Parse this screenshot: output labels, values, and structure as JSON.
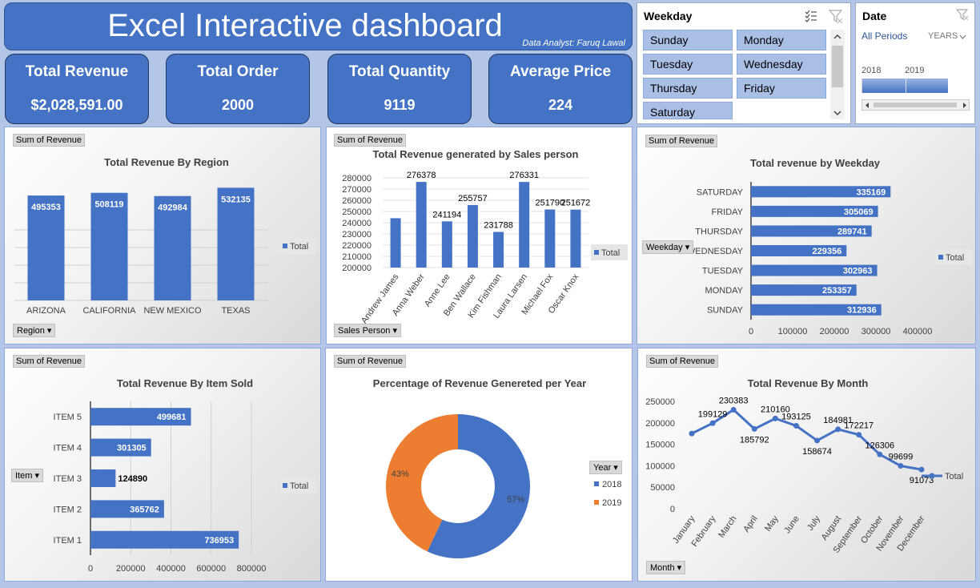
{
  "header": {
    "title": "Excel Interactive dashboard",
    "analyst": "Data Analyst: Faruq Lawal"
  },
  "kpis": [
    {
      "label": "Total Revenue",
      "value": "$2,028,591.00"
    },
    {
      "label": "Total Order",
      "value": "2000"
    },
    {
      "label": "Total Quantity",
      "value": "9119"
    },
    {
      "label": "Average Price",
      "value": "224"
    }
  ],
  "weekday_slicer": {
    "title": "Weekday",
    "items": [
      "Sunday",
      "Monday",
      "Tuesday",
      "Wednesday",
      "Thursday",
      "Friday",
      "Saturday"
    ]
  },
  "date_slicer": {
    "title": "Date",
    "period": "All Periods",
    "level": "YEARS",
    "years": [
      "2018",
      "2019"
    ]
  },
  "field_buttons": {
    "sum": "Sum of Revenue",
    "region": "Region",
    "sales_person": "Sales Person",
    "weekday": "Weekday",
    "item": "Item",
    "year": "Year",
    "month": "Month"
  },
  "colors": {
    "blue": "#4472c4",
    "orange": "#ed7d31",
    "header": "#4472c4",
    "background": "#b4c6e7"
  },
  "chart_data": [
    {
      "id": "region",
      "type": "bar",
      "title": "Total Revenue By Region",
      "categories": [
        "ARIZONA",
        "CALIFORNIA",
        "NEW MEXICO",
        "TEXAS"
      ],
      "series": [
        {
          "name": "Total",
          "values": [
            495353,
            508119,
            492984,
            532135
          ]
        }
      ],
      "legend": "right"
    },
    {
      "id": "salesperson",
      "type": "bar",
      "title": "Total Revenue generated by Sales person",
      "categories": [
        "Andrew James",
        "Anna Weber",
        "Anne Lee",
        "Ben Wallace",
        "Kim Fishman",
        "Laura Larsen",
        "Michael Fox",
        "Oscar Knox"
      ],
      "series": [
        {
          "name": "Total",
          "values": [
            244000,
            276378,
            241194,
            255757,
            231788,
            276331,
            251790,
            251672
          ]
        }
      ],
      "ylim": [
        200000,
        280000
      ],
      "yticks": [
        "200000",
        "210000",
        "220000",
        "230000",
        "240000",
        "250000",
        "260000",
        "270000",
        "280000"
      ],
      "data_labels": [
        "",
        "276378",
        "241194",
        "255757",
        "231788",
        "276331",
        "251790",
        "251672"
      ],
      "legend": "right"
    },
    {
      "id": "weekday",
      "type": "bar",
      "orientation": "horizontal",
      "title": "Total revenue by Weekday",
      "categories": [
        "SATURDAY",
        "FRIDAY",
        "THURSDAY",
        "WEDNESDAY",
        "TUESDAY",
        "MONDAY",
        "SUNDAY"
      ],
      "series": [
        {
          "name": "Total",
          "values": [
            335169,
            305069,
            289741,
            229356,
            302963,
            253357,
            312936
          ]
        }
      ],
      "xlim": [
        0,
        400000
      ],
      "xticks": [
        "0",
        "100000",
        "200000",
        "300000",
        "400000"
      ],
      "legend": "right"
    },
    {
      "id": "item",
      "type": "bar",
      "orientation": "horizontal",
      "title": "Total Revenue By Item Sold",
      "categories": [
        "ITEM 5",
        "ITEM 4",
        "ITEM 3",
        "ITEM 2",
        "ITEM 1"
      ],
      "series": [
        {
          "name": "Total",
          "values": [
            499681,
            301305,
            124890,
            365762,
            736953
          ]
        }
      ],
      "xlim": [
        0,
        800000
      ],
      "xticks": [
        "0",
        "200000",
        "400000",
        "600000",
        "800000"
      ],
      "legend": "right"
    },
    {
      "id": "year",
      "type": "pie",
      "title": "Percentage of Revenue Genereted per Year",
      "categories": [
        "2018",
        "2019"
      ],
      "values": [
        57,
        43
      ],
      "labels": [
        "57%",
        "43%"
      ],
      "legend": "right"
    },
    {
      "id": "month",
      "type": "line",
      "title": "Total Revenue By Month",
      "categories": [
        "January",
        "February",
        "March",
        "April",
        "May",
        "June",
        "July",
        "August",
        "September",
        "October",
        "November",
        "December"
      ],
      "series": [
        {
          "name": "Total",
          "values": [
            175000,
            199129,
            230383,
            185792,
            210160,
            193125,
            158674,
            184981,
            172217,
            126306,
            99699,
            91073
          ]
        }
      ],
      "data_labels": [
        "",
        "199129",
        "230383",
        "185792",
        "210160",
        "193125",
        "158674",
        "184981",
        "172217",
        "126306",
        "99699",
        "91073"
      ],
      "ylim": [
        0,
        250000
      ],
      "yticks": [
        "0",
        "50000",
        "100000",
        "150000",
        "200000",
        "250000"
      ],
      "legend": "right"
    }
  ]
}
